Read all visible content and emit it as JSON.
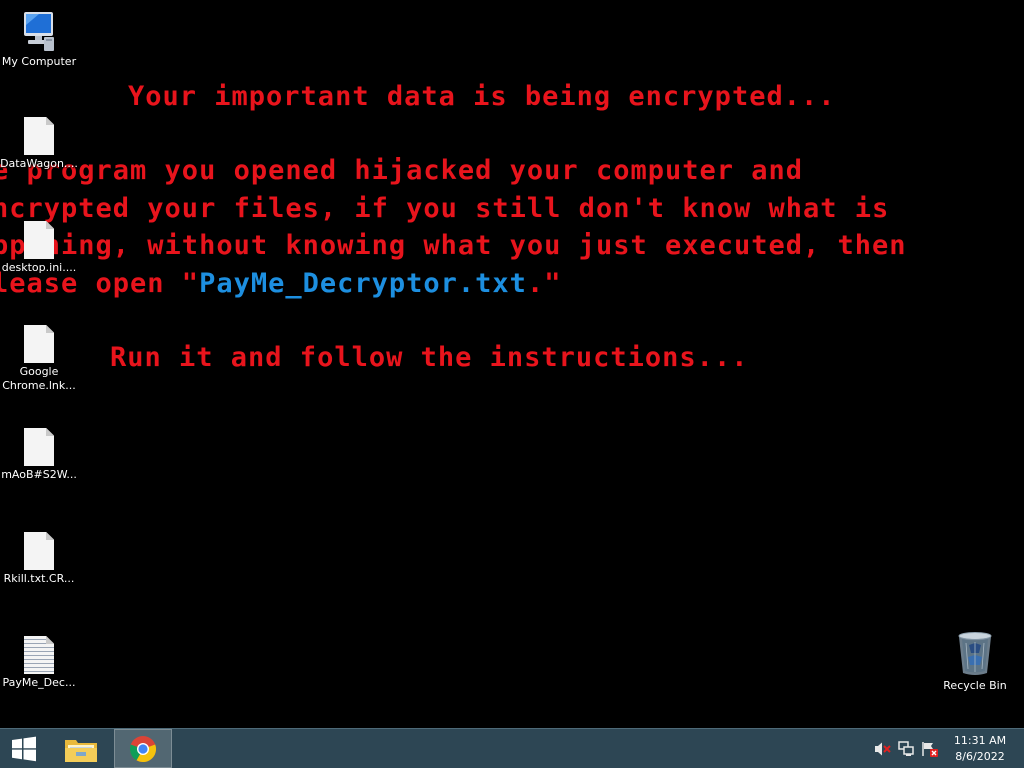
{
  "ransom_note": {
    "line1": "Your important data is being encrypted...",
    "line2": "e program you opened hijacked your computer and",
    "line3": "ncrypted your files, if you still don't know what is",
    "line4": "ppening, without knowing what you just executed, then",
    "line5_prefix": "lease open \"",
    "line5_link": "PayMe_Decryptor.txt",
    "line5_suffix": ".\"",
    "line6": "Run it and follow the instructions...",
    "colors": {
      "text": "#e8141c",
      "link": "#1d8fe0",
      "background": "#000000"
    }
  },
  "desktop_icons": [
    {
      "label": "My Computer",
      "icon": "computer-icon"
    },
    {
      "label": "DataWagon....",
      "icon": "file-icon"
    },
    {
      "label": "desktop.ini....",
      "icon": "file-icon"
    },
    {
      "label": "Google Chrome.lnk...",
      "icon": "file-icon"
    },
    {
      "label": "mAoB#S2W...",
      "icon": "file-icon"
    },
    {
      "label": "Rkill.txt.CR...",
      "icon": "file-icon"
    },
    {
      "label": "PayMe_Dec...",
      "icon": "text-file-icon"
    },
    {
      "label": "Recycle Bin",
      "icon": "recycle-bin-icon"
    }
  ],
  "taskbar": {
    "pinned": [
      "windows-start-icon",
      "file-explorer-icon",
      "chrome-icon"
    ],
    "tray": [
      "speaker-muted-icon",
      "network-icon",
      "action-center-icon"
    ],
    "clock": {
      "time": "11:31 AM",
      "date": "8/6/2022"
    },
    "color": "#2d4654"
  }
}
